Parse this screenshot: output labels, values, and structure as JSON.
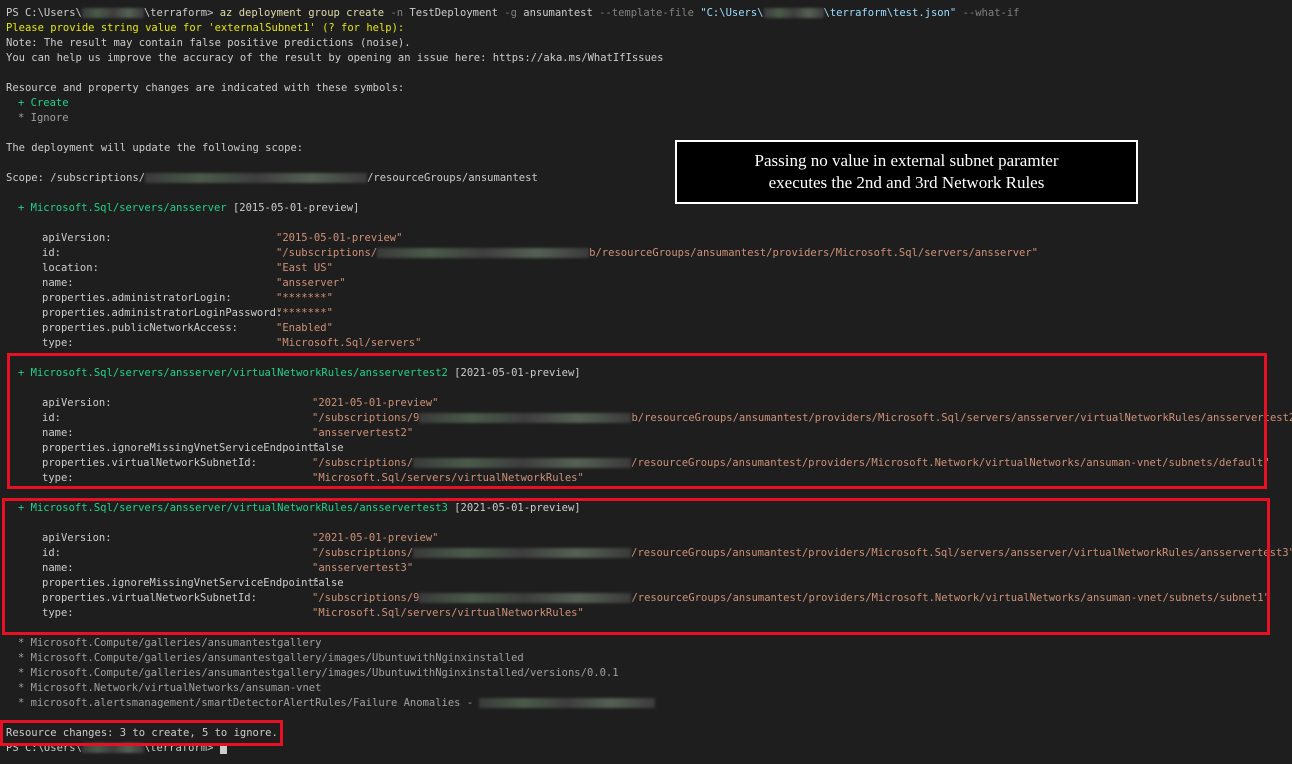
{
  "terminal": {
    "prompt_prefix": "PS C:\\Users\\",
    "prompt_suffix": "\\terraform>",
    "command": {
      "az": "az deployment group create",
      "n_flag": "-n",
      "n_value": "TestDeployment",
      "g_flag": "-g",
      "g_value": "ansumantest",
      "tf_flag": "--template-file",
      "tf_value_prefix": "\"C:\\Users\\",
      "tf_value_suffix": "\\terraform\\test.json\"",
      "whatif": "--what-if"
    },
    "prompt_line": "Please provide string value for 'externalSubnet1' (? for help):",
    "note_line": "Note: The result may contain false positive predictions (noise).",
    "help_line": "You can help us improve the accuracy of the result by opening an issue here: https://aka.ms/WhatIfIssues",
    "symbols_header": "Resource and property changes are indicated with these symbols:",
    "symbol_create": "+ Create",
    "symbol_ignore": "* Ignore",
    "scope_header": "The deployment will update the following scope:",
    "scope_prefix": "Scope: /subscriptions/",
    "scope_suffix": "/resourceGroups/ansumantest",
    "resources": [
      {
        "header": "+ Microsoft.Sql/servers/ansserver",
        "version": "[2015-05-01-preview]",
        "props": [
          {
            "k": "apiVersion:",
            "v": "\"2015-05-01-preview\""
          },
          {
            "k": "id:",
            "v_prefix": "\"/subscriptions/",
            "v_suffix": "b/resourceGroups/ansumantest/providers/Microsoft.Sql/servers/ansserver\""
          },
          {
            "k": "location:",
            "v": "\"East US\""
          },
          {
            "k": "name:",
            "v": "\"ansserver\""
          },
          {
            "k": "properties.administratorLogin:",
            "v": "\"*******\""
          },
          {
            "k": "properties.administratorLoginPassword:",
            "v": "\"*******\""
          },
          {
            "k": "properties.publicNetworkAccess:",
            "v": "\"Enabled\""
          },
          {
            "k": "type:",
            "v": "\"Microsoft.Sql/servers\""
          }
        ]
      },
      {
        "header": "+ Microsoft.Sql/servers/ansserver/virtualNetworkRules/ansservertest2",
        "version": "[2021-05-01-preview]",
        "props": [
          {
            "k": "apiVersion:",
            "v": "\"2021-05-01-preview\""
          },
          {
            "k": "id:",
            "v_prefix": "\"/subscriptions/9",
            "v_suffix": "b/resourceGroups/ansumantest/providers/Microsoft.Sql/servers/ansserver/virtualNetworkRules/ansservertest2\""
          },
          {
            "k": "name:",
            "v": "\"ansservertest2\""
          },
          {
            "k": "properties.ignoreMissingVnetServiceEndpoint:",
            "v": "false"
          },
          {
            "k": "properties.virtualNetworkSubnetId:",
            "v_prefix": "\"/subscriptions/",
            "v_suffix": "/resourceGroups/ansumantest/providers/Microsoft.Network/virtualNetworks/ansuman-vnet/subnets/default\""
          },
          {
            "k": "type:",
            "v": "\"Microsoft.Sql/servers/virtualNetworkRules\""
          }
        ]
      },
      {
        "header": "+ Microsoft.Sql/servers/ansserver/virtualNetworkRules/ansservertest3",
        "version": "[2021-05-01-preview]",
        "props": [
          {
            "k": "apiVersion:",
            "v": "\"2021-05-01-preview\""
          },
          {
            "k": "id:",
            "v_prefix": "\"/subscriptions/",
            "v_suffix": "/resourceGroups/ansumantest/providers/Microsoft.Sql/servers/ansserver/virtualNetworkRules/ansservertest3\""
          },
          {
            "k": "name:",
            "v": "\"ansservertest3\""
          },
          {
            "k": "properties.ignoreMissingVnetServiceEndpoint:",
            "v": "false"
          },
          {
            "k": "properties.virtualNetworkSubnetId:",
            "v_prefix": "\"/subscriptions/9",
            "v_suffix": "/resourceGroups/ansumantest/providers/Microsoft.Network/virtualNetworks/ansuman-vnet/subnets/subnet1\""
          },
          {
            "k": "type:",
            "v": "\"Microsoft.Sql/servers/virtualNetworkRules\""
          }
        ]
      }
    ],
    "ignored": [
      "* Microsoft.Compute/galleries/ansumantestgallery",
      "* Microsoft.Compute/galleries/ansumantestgallery/images/UbuntuwithNginxinstalled",
      "* Microsoft.Compute/galleries/ansumantestgallery/images/UbuntuwithNginxinstalled/versions/0.0.1",
      "* Microsoft.Network/virtualNetworks/ansuman-vnet",
      "* microsoft.alertsmanagement/smartDetectorAlertRules/Failure Anomalies - "
    ],
    "summary": "Resource changes: 3 to create, 5 to ignore."
  },
  "annotation": {
    "line1": "Passing no value in external subnet paramter",
    "line2": "executes the 2nd and 3rd Network Rules"
  },
  "colors": {
    "background": "#1e1e1e",
    "highlight_box": "#e81123",
    "create_green": "#23d18b",
    "prompt_yellow": "#e5e510"
  }
}
